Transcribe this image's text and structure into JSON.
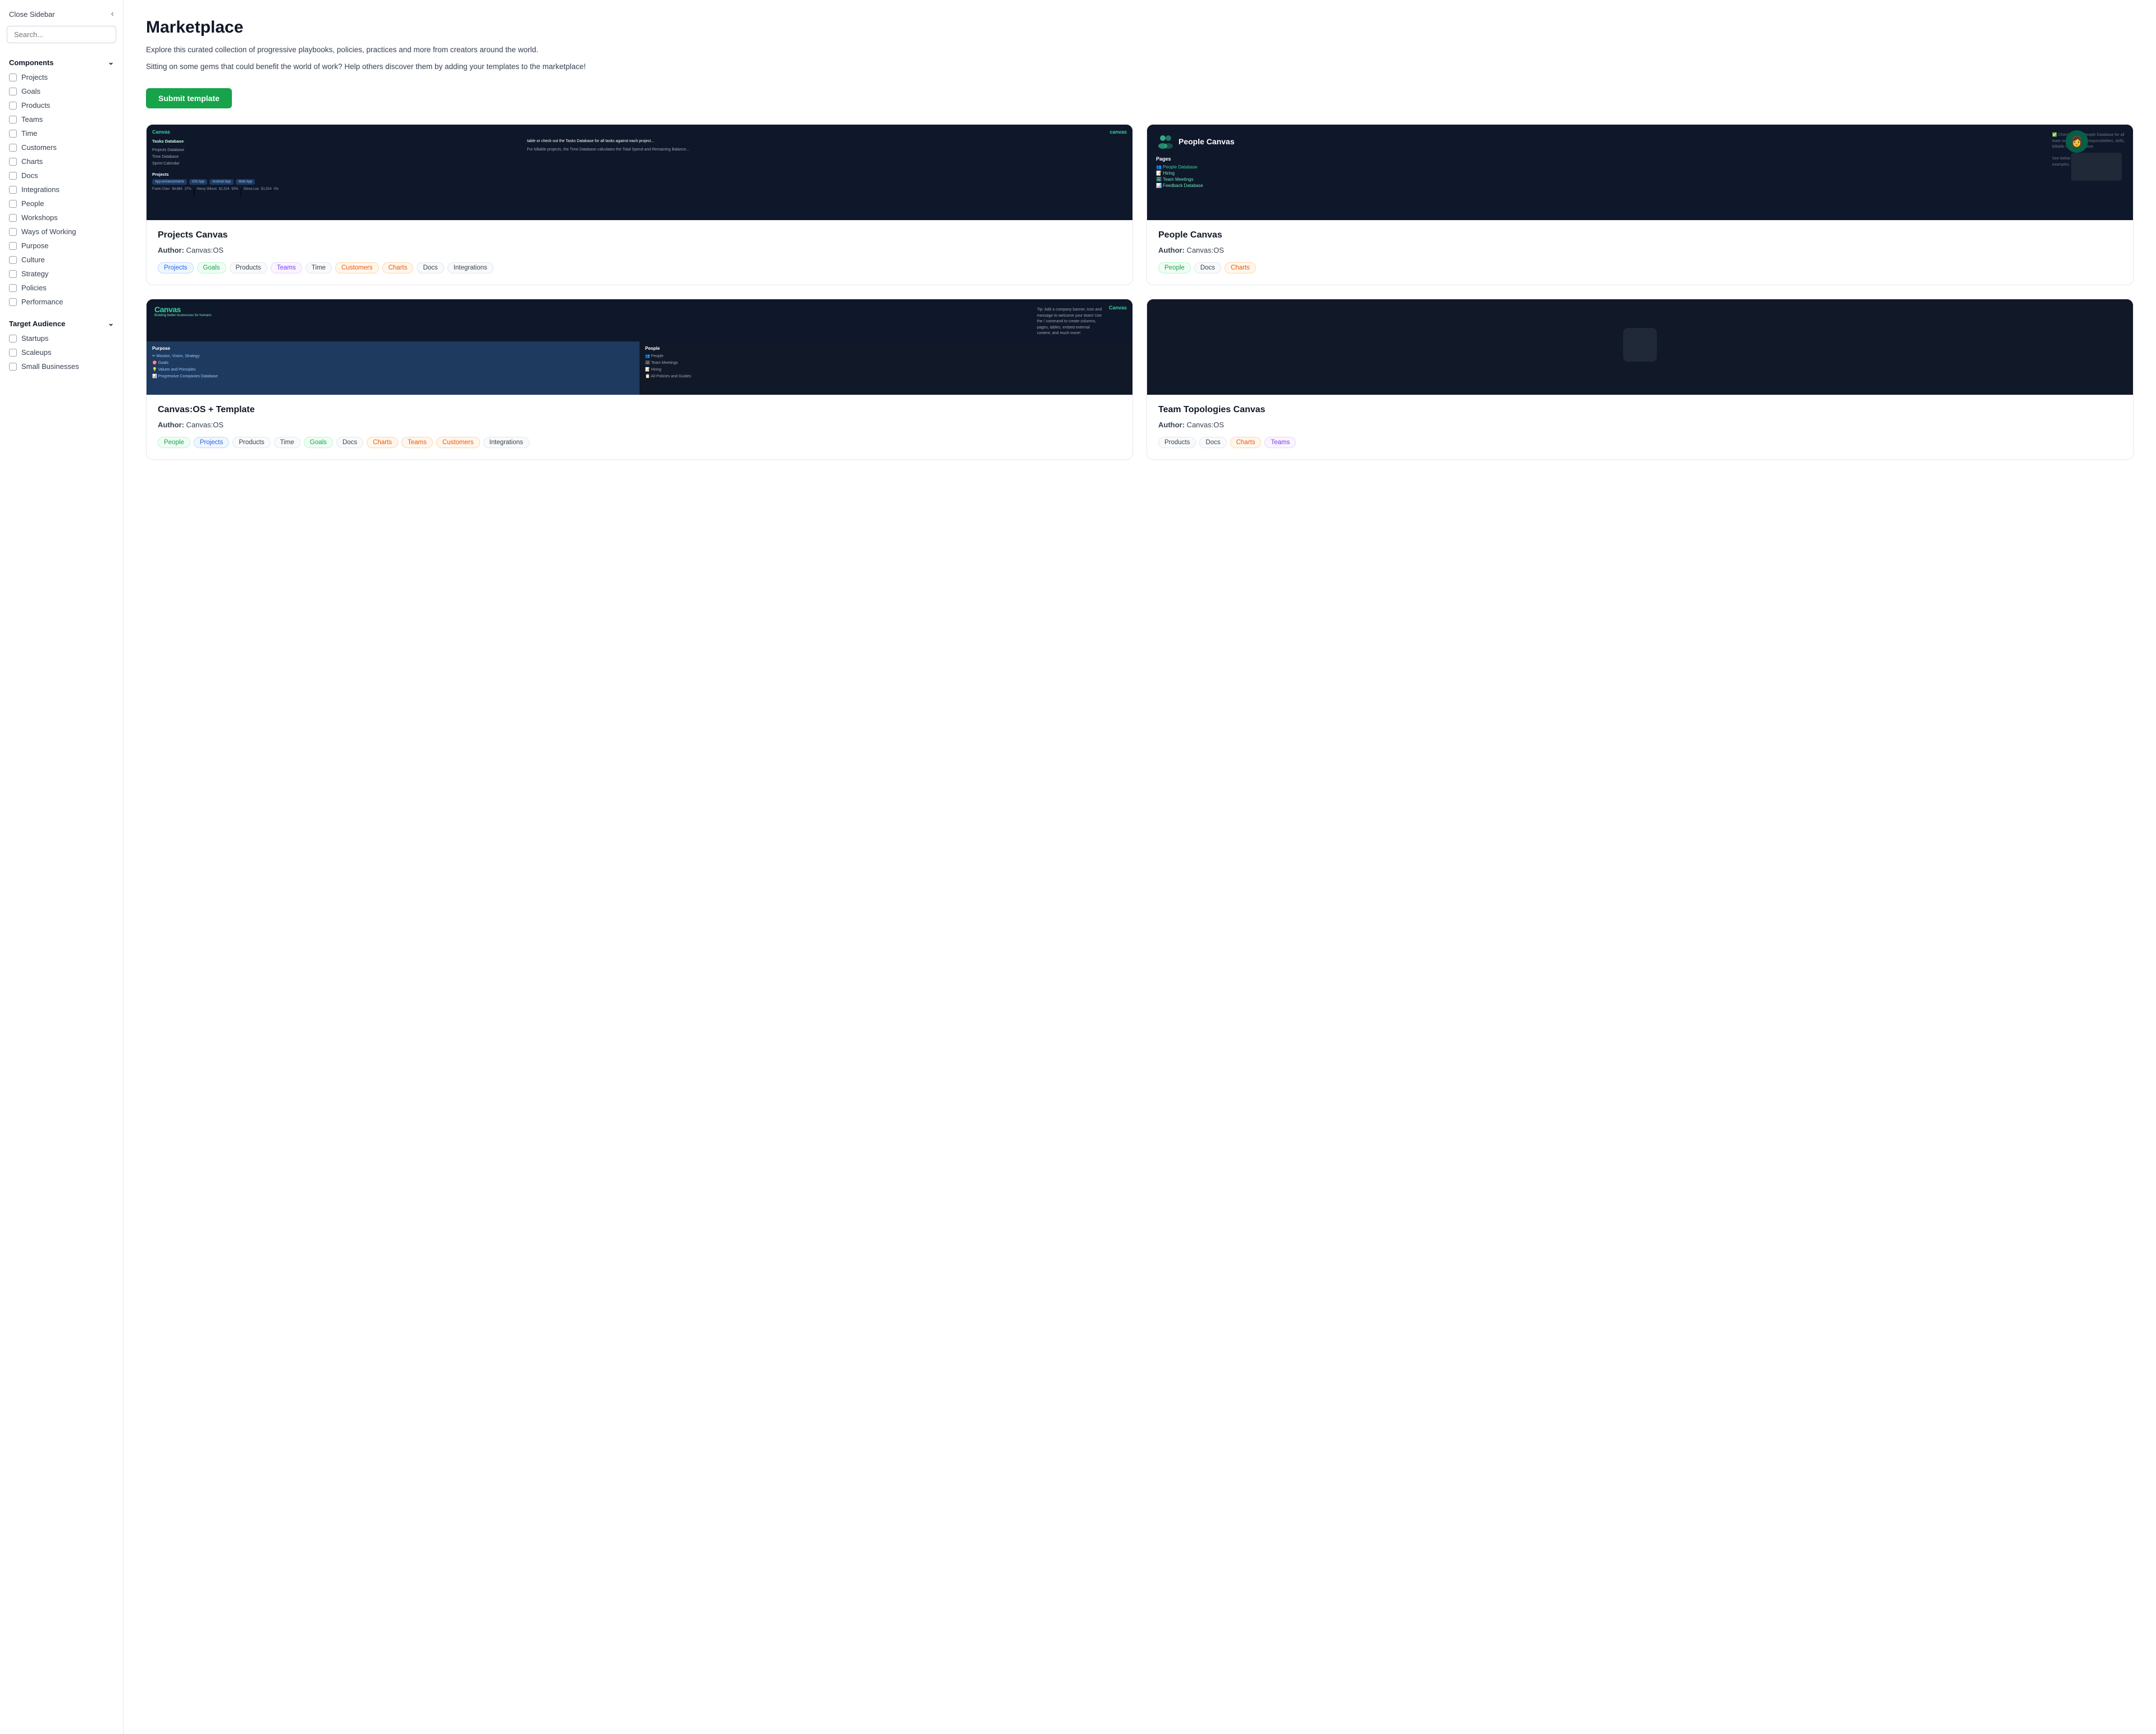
{
  "sidebar": {
    "close_label": "Close Sidebar",
    "search_placeholder": "Search...",
    "components_label": "Components",
    "target_audience_label": "Target Audience",
    "components_items": [
      "Projects",
      "Goals",
      "Products",
      "Teams",
      "Time",
      "Customers",
      "Charts",
      "Docs",
      "Integrations",
      "People",
      "Workshops",
      "Ways of Working",
      "Purpose",
      "Culture",
      "Strategy",
      "Policies",
      "Performance"
    ],
    "target_items": [
      "Startups",
      "Scaleups",
      "Small Businesses"
    ]
  },
  "main": {
    "title": "Marketplace",
    "desc1": "Explore this curated collection of progressive playbooks, policies, practices and more from creators around the world.",
    "desc2": "Sitting on some gems that could benefit the world of work? Help others discover them by adding your templates to the marketplace!",
    "submit_label": "Submit template",
    "cards": [
      {
        "id": "projects-canvas",
        "title": "Projects Canvas",
        "author": "Canvas:OS",
        "preview_type": "projects",
        "tags": [
          {
            "label": "Projects",
            "style": "blue"
          },
          {
            "label": "Goals",
            "style": "green"
          },
          {
            "label": "Products",
            "style": "gray"
          },
          {
            "label": "Teams",
            "style": "purple"
          },
          {
            "label": "Time",
            "style": "gray"
          },
          {
            "label": "Customers",
            "style": "orange"
          },
          {
            "label": "Charts",
            "style": "orange"
          },
          {
            "label": "Docs",
            "style": "gray"
          },
          {
            "label": "Integrations",
            "style": "gray"
          }
        ]
      },
      {
        "id": "people-canvas",
        "title": "People Canvas",
        "author": "Canvas:OS",
        "preview_type": "people",
        "tags": [
          {
            "label": "People",
            "style": "green"
          },
          {
            "label": "Docs",
            "style": "gray"
          },
          {
            "label": "Charts",
            "style": "orange"
          }
        ]
      },
      {
        "id": "canvasos-template",
        "title": "Canvas:OS + Template",
        "author": "Canvas:OS",
        "preview_type": "canvasos",
        "tags": [
          {
            "label": "People",
            "style": "green"
          },
          {
            "label": "Projects",
            "style": "blue"
          },
          {
            "label": "Products",
            "style": "gray"
          },
          {
            "label": "Time",
            "style": "gray"
          },
          {
            "label": "Goals",
            "style": "green"
          },
          {
            "label": "Docs",
            "style": "gray"
          },
          {
            "label": "Charts",
            "style": "orange"
          },
          {
            "label": "Teams",
            "style": "orange"
          },
          {
            "label": "Customers",
            "style": "orange"
          },
          {
            "label": "Integrations",
            "style": "gray"
          }
        ]
      },
      {
        "id": "team-topologies",
        "title": "Team Topologies Canvas",
        "author": "Canvas:OS",
        "preview_type": "team-topologies",
        "tags": [
          {
            "label": "Products",
            "style": "gray"
          },
          {
            "label": "Docs",
            "style": "gray"
          },
          {
            "label": "Charts",
            "style": "orange"
          },
          {
            "label": "Teams",
            "style": "purple"
          }
        ]
      }
    ]
  }
}
